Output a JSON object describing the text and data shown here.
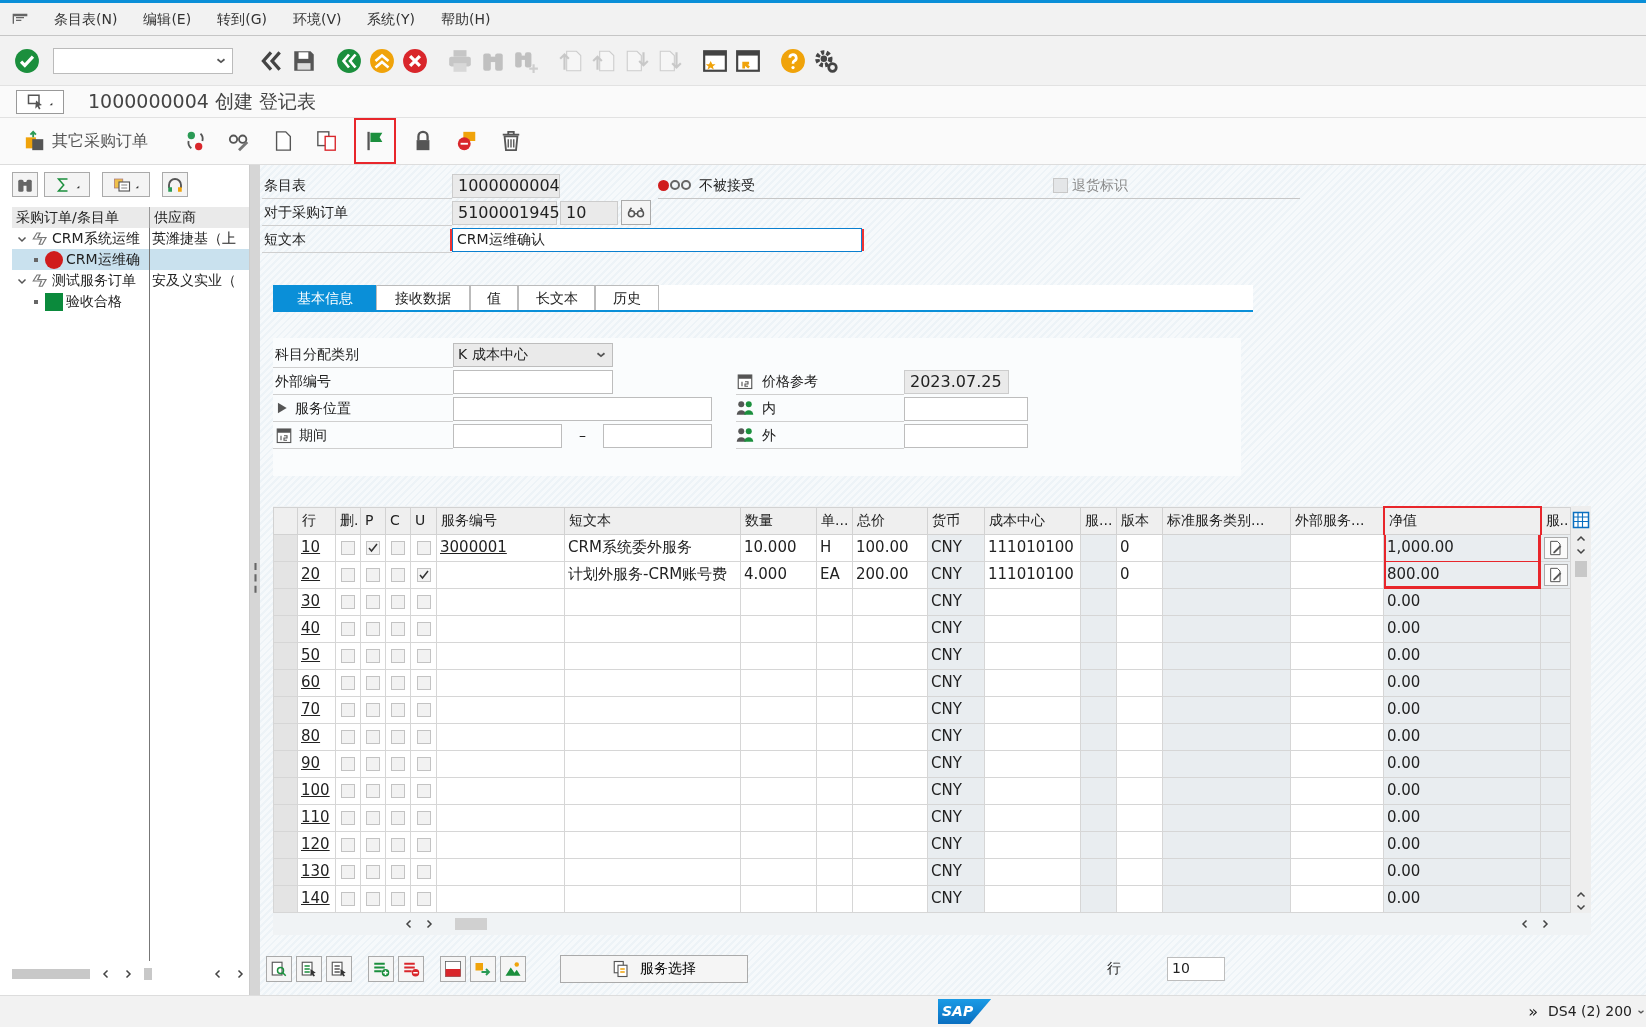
{
  "menu": [
    {
      "label": "条目表(N)"
    },
    {
      "label": "编辑(E)"
    },
    {
      "label": "转到(G)"
    },
    {
      "label": "环境(V)"
    },
    {
      "label": "系统(Y)"
    },
    {
      "label": "帮助(H)"
    }
  ],
  "standard_toolbar": [
    {
      "kind": "enter",
      "disabled": false
    },
    {
      "kind": "command-field",
      "disabled": false
    },
    {
      "kind": "previous",
      "disabled": false
    },
    {
      "kind": "save",
      "disabled": false
    },
    {
      "kind": "back",
      "disabled": false
    },
    {
      "kind": "exit",
      "disabled": false
    },
    {
      "kind": "cancel",
      "disabled": false
    },
    {
      "kind": "print",
      "disabled": true
    },
    {
      "kind": "find",
      "disabled": true
    },
    {
      "kind": "find-next",
      "disabled": true
    },
    {
      "kind": "first-page",
      "disabled": true
    },
    {
      "kind": "previous-page",
      "disabled": true
    },
    {
      "kind": "next-page",
      "disabled": true
    },
    {
      "kind": "last-page",
      "disabled": true
    },
    {
      "kind": "new-session",
      "disabled": false
    },
    {
      "kind": "shortcut",
      "disabled": false
    },
    {
      "kind": "help",
      "disabled": false
    },
    {
      "kind": "settings",
      "disabled": false
    }
  ],
  "title": "1000000004 创建 登记表",
  "app_toolbar": [
    {
      "kind": "other-po",
      "label": "其它采购订单",
      "highlighted": false
    },
    {
      "kind": "status",
      "highlighted": false
    },
    {
      "kind": "glasses",
      "highlighted": false
    },
    {
      "kind": "new-document",
      "highlighted": false
    },
    {
      "kind": "copy",
      "highlighted": false
    },
    {
      "kind": "flag",
      "highlighted": true
    },
    {
      "kind": "lock",
      "highlighted": false
    },
    {
      "kind": "stamp",
      "highlighted": false
    },
    {
      "kind": "trash",
      "highlighted": false
    }
  ],
  "tree": {
    "columns": [
      "采购订单/条目单",
      "供应商"
    ],
    "nodes": [
      {
        "label": "CRM系统运维",
        "supplier": "英潍捷基（上",
        "expanded": true,
        "selected": false,
        "children": [
          {
            "label": "CRM运维确",
            "kind": "circle",
            "color": "#d01c1c",
            "selected": true
          }
        ]
      },
      {
        "label": "测试服务订单",
        "supplier": "安及义实业（",
        "expanded": true,
        "selected": false,
        "children": [
          {
            "label": "验收合格",
            "kind": "square",
            "color": "#0b8a3c",
            "selected": false
          }
        ]
      }
    ]
  },
  "header": {
    "entry_sheet": {
      "label": "条目表",
      "value": "1000000004"
    },
    "purchase_order": {
      "label": "对于采购订单",
      "value": "5100001945",
      "item": "10"
    },
    "short_text": {
      "label": "短文本",
      "value": "CRM运维确认"
    },
    "status": {
      "lights": [
        {
          "color": "#d01c1c",
          "on": true
        },
        {
          "on": false
        },
        {
          "on": false
        }
      ],
      "text": "不被接受"
    },
    "return_flag": {
      "label": "退货标识",
      "checked": false,
      "disabled": true
    }
  },
  "tabs": [
    {
      "label": "基本信息",
      "selected": true
    },
    {
      "label": "接收数据",
      "selected": false
    },
    {
      "label": "值",
      "selected": false
    },
    {
      "label": "长文本",
      "selected": false
    },
    {
      "label": "历史",
      "selected": false
    }
  ],
  "basic_data": {
    "account_assignment": {
      "label": "科目分配类别",
      "value": "K 成本中心"
    },
    "external_number": {
      "label": "外部编号"
    },
    "service_location": {
      "label": "服务位置",
      "expanded": false
    },
    "period": {
      "label": "期间",
      "separator": "–"
    },
    "price_reference": {
      "label": "价格参考",
      "value": "2023.07.25"
    },
    "internal": {
      "label": "内"
    },
    "external": {
      "label": "外"
    }
  },
  "table": {
    "columns": [
      {
        "label": "行",
        "highlighted": false,
        "readonly": false
      },
      {
        "label": "删.",
        "highlighted": false,
        "readonly": false
      },
      {
        "label": "P",
        "highlighted": false,
        "readonly": false
      },
      {
        "label": "C",
        "highlighted": false,
        "readonly": false
      },
      {
        "label": "U",
        "highlighted": false,
        "readonly": false
      },
      {
        "label": "服务编号",
        "highlighted": false,
        "readonly": false
      },
      {
        "label": "短文本",
        "highlighted": false,
        "readonly": false
      },
      {
        "label": "数量",
        "highlighted": false,
        "readonly": false
      },
      {
        "label": "单...",
        "highlighted": false,
        "readonly": false
      },
      {
        "label": "总价",
        "highlighted": false,
        "readonly": false
      },
      {
        "label": "货币",
        "highlighted": false,
        "readonly": true
      },
      {
        "label": "成本中心",
        "highlighted": false,
        "readonly": false
      },
      {
        "label": "服...",
        "highlighted": false,
        "readonly": true
      },
      {
        "label": "版本",
        "highlighted": false,
        "readonly": false
      },
      {
        "label": "标准服务类别...",
        "highlighted": false,
        "readonly": true
      },
      {
        "label": "外部服务...",
        "highlighted": false,
        "readonly": false
      },
      {
        "label": "净值",
        "highlighted": true,
        "readonly": true
      },
      {
        "label": "服..",
        "highlighted": false,
        "readonly": true
      }
    ],
    "rows": [
      {
        "line": "10",
        "deleted": false,
        "p": true,
        "c": false,
        "u": false,
        "service_number": "3000001",
        "short_text": "CRM系统委外服务",
        "quantity": "10.000",
        "unit": "H",
        "gross_price": "100.00",
        "currency": "CNY",
        "cost_center": "111010100",
        "version": "0",
        "net_value": "1,000.00",
        "detail": true,
        "highlighted": true
      },
      {
        "line": "20",
        "deleted": false,
        "p": false,
        "c": false,
        "u": true,
        "short_text": "计划外服务-CRM账号费",
        "quantity": "4.000",
        "unit": "EA",
        "gross_price": "200.00",
        "currency": "CNY",
        "cost_center": "111010100",
        "version": "0",
        "net_value": "800.00",
        "detail": true,
        "highlighted": true
      },
      {
        "line": "30",
        "deleted": false,
        "p": false,
        "c": false,
        "u": false,
        "currency": "CNY",
        "net_value": "0.00",
        "detail": false,
        "highlighted": false
      },
      {
        "line": "40",
        "deleted": false,
        "p": false,
        "c": false,
        "u": false,
        "currency": "CNY",
        "net_value": "0.00",
        "detail": false,
        "highlighted": false
      },
      {
        "line": "50",
        "deleted": false,
        "p": false,
        "c": false,
        "u": false,
        "currency": "CNY",
        "net_value": "0.00",
        "detail": false,
        "highlighted": false
      },
      {
        "line": "60",
        "deleted": false,
        "p": false,
        "c": false,
        "u": false,
        "currency": "CNY",
        "net_value": "0.00",
        "detail": false,
        "highlighted": false
      },
      {
        "line": "70",
        "deleted": false,
        "p": false,
        "c": false,
        "u": false,
        "currency": "CNY",
        "net_value": "0.00",
        "detail": false,
        "highlighted": false
      },
      {
        "line": "80",
        "deleted": false,
        "p": false,
        "c": false,
        "u": false,
        "currency": "CNY",
        "net_value": "0.00",
        "detail": false,
        "highlighted": false
      },
      {
        "line": "90",
        "deleted": false,
        "p": false,
        "c": false,
        "u": false,
        "currency": "CNY",
        "net_value": "0.00",
        "detail": false,
        "highlighted": false
      },
      {
        "line": "100",
        "deleted": false,
        "p": false,
        "c": false,
        "u": false,
        "currency": "CNY",
        "net_value": "0.00",
        "detail": false,
        "highlighted": false
      },
      {
        "line": "110",
        "deleted": false,
        "p": false,
        "c": false,
        "u": false,
        "currency": "CNY",
        "net_value": "0.00",
        "detail": false,
        "highlighted": false
      },
      {
        "line": "120",
        "deleted": false,
        "p": false,
        "c": false,
        "u": false,
        "currency": "CNY",
        "net_value": "0.00",
        "detail": false,
        "highlighted": false
      },
      {
        "line": "130",
        "deleted": false,
        "p": false,
        "c": false,
        "u": false,
        "currency": "CNY",
        "net_value": "0.00",
        "detail": false,
        "highlighted": false
      },
      {
        "line": "140",
        "deleted": false,
        "p": false,
        "c": false,
        "u": false,
        "currency": "CNY",
        "net_value": "0.00",
        "detail": false,
        "highlighted": false
      }
    ]
  },
  "bottom_bar": {
    "service_selection": "服务选择",
    "line_label": "行",
    "line_value": "10"
  },
  "status_bar": {
    "logo": "SAP",
    "expand": "»",
    "system": "DS4 (2) 200"
  }
}
